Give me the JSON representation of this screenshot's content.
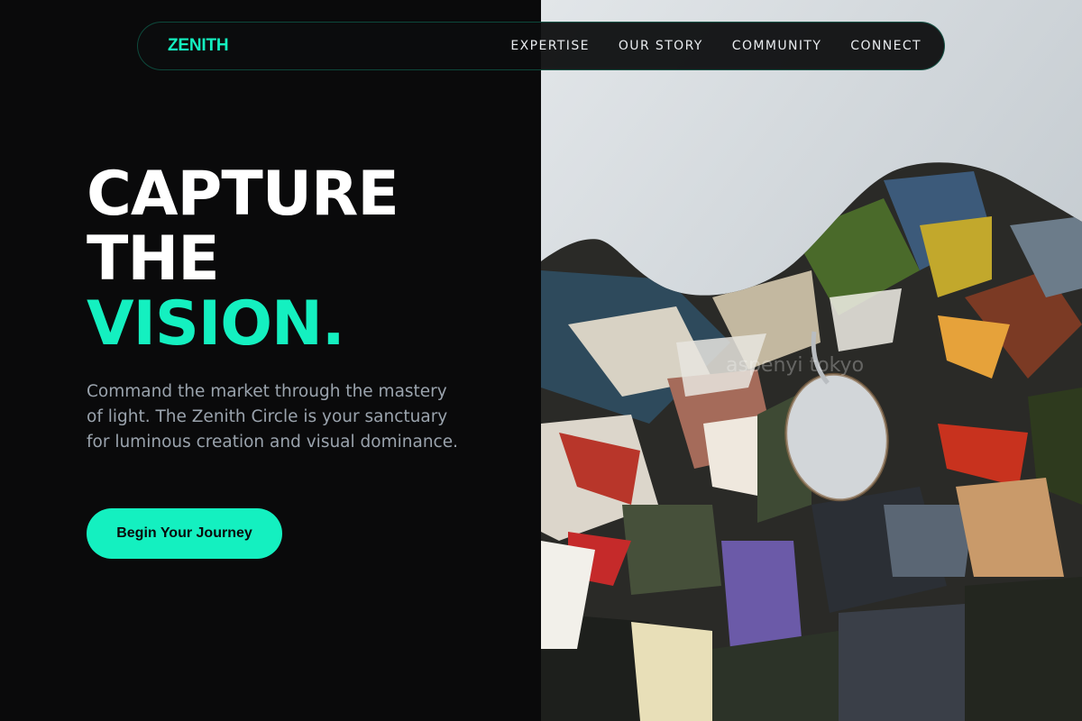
{
  "nav": {
    "logo": "ZENITH",
    "links": [
      "EXPERTISE",
      "OUR STORY",
      "COMMUNITY",
      "CONNECT"
    ]
  },
  "hero": {
    "title_lines": [
      "CAPTURE",
      "THE"
    ],
    "title_accent": "VISION.",
    "description": "Command the market through the mastery of light. The Zenith Circle is your sanctuary for luminous creation and visual dominance.",
    "cta_label": "Begin Your Journey"
  },
  "artwork": {
    "subject": "paint-palette-photo",
    "watermark": "aspenyi tokyo"
  },
  "colors": {
    "background": "#0a0a0b",
    "accent": "#14f0c0",
    "text": "#ffffff",
    "muted_text": "#9aa3ad"
  }
}
